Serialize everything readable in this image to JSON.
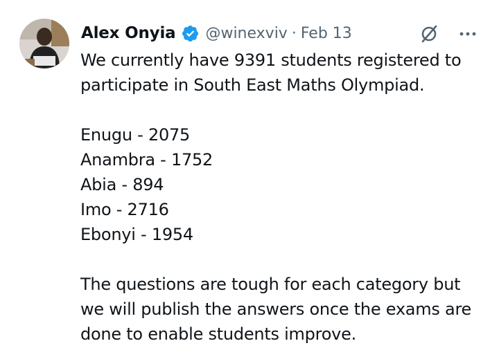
{
  "author": {
    "display_name": "Alex Onyia",
    "handle": "@winexviv",
    "separator": "·",
    "date": "Feb 13",
    "verified": true
  },
  "icons": {
    "verified": "verified-badge-icon",
    "grok": "grok-icon",
    "more": "more-options-icon"
  },
  "colors": {
    "verified_blue": "#1d9bf0",
    "secondary_text": "#536471",
    "primary_text": "#0f1419"
  },
  "tweet": {
    "intro_line1": "We currently have 9391 students registered to",
    "intro_line2": "participate in South East Maths Olympiad.",
    "states": [
      {
        "text": "Enugu - 2075"
      },
      {
        "text": "Anambra - 1752"
      },
      {
        "text": "Abia - 894"
      },
      {
        "text": "Imo - 2716"
      },
      {
        "text": "Ebonyi - 1954"
      }
    ],
    "closing_line1": "The questions are tough for each category but",
    "closing_line2": "we will publish the answers once the exams are",
    "closing_line3": "done to enable students improve."
  }
}
